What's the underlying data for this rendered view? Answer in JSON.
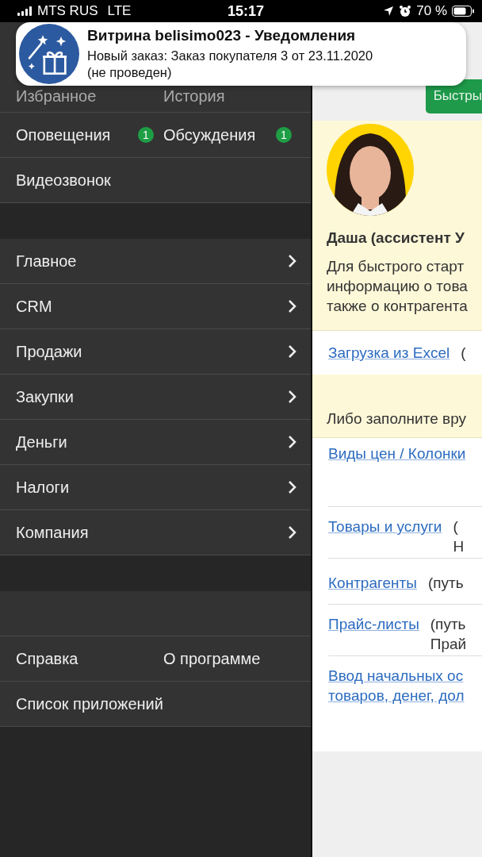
{
  "status_bar": {
    "carrier": "MTS RUS",
    "network": "LTE",
    "time": "15:17",
    "battery": "70 %"
  },
  "notification": {
    "title": "Витрина belisimo023 - Уведомления",
    "body": "Новый заказ: Заказ покупателя 3 от 23.11.2020 (не проведен)"
  },
  "sidebar": {
    "top_rows": [
      [
        {
          "label": "Избранное"
        },
        {
          "label": "История"
        }
      ],
      [
        {
          "label": "Оповещения",
          "badge": "1"
        },
        {
          "label": "Обсуждения",
          "badge": "1"
        }
      ],
      [
        {
          "label": "Видеозвонок"
        }
      ]
    ],
    "sections": [
      {
        "label": "Главное"
      },
      {
        "label": "CRM"
      },
      {
        "label": "Продажи"
      },
      {
        "label": "Закупки"
      },
      {
        "label": "Деньги"
      },
      {
        "label": "Налоги"
      },
      {
        "label": "Компания"
      }
    ],
    "bottom_rows": [
      [
        {
          "label": "Справка"
        },
        {
          "label": "О программе"
        }
      ],
      [
        {
          "label": "Список приложений"
        }
      ]
    ]
  },
  "content": {
    "quick_button": "Быстры",
    "assistant_name": "Даша (ассистент У",
    "intro": [
      "Для быстрого старт",
      "информацию о това",
      "также о контрагента"
    ],
    "excel": {
      "link": "Загрузка из Excel",
      "note": [
        "("
      ]
    },
    "manual": "Либо заполните вру",
    "links": [
      {
        "link": "Виды цен / Колонки"
      },
      {
        "link": "Товары и услуги",
        "note": [
          "(",
          "Н"
        ]
      },
      {
        "link": "Контрагенты",
        "note": [
          "(путь"
        ]
      },
      {
        "link": "Прайс-листы",
        "note": [
          "(путь",
          "Прай"
        ]
      },
      {
        "link": "Ввод начальных ос\nтоваров, денег, дол"
      }
    ]
  }
}
